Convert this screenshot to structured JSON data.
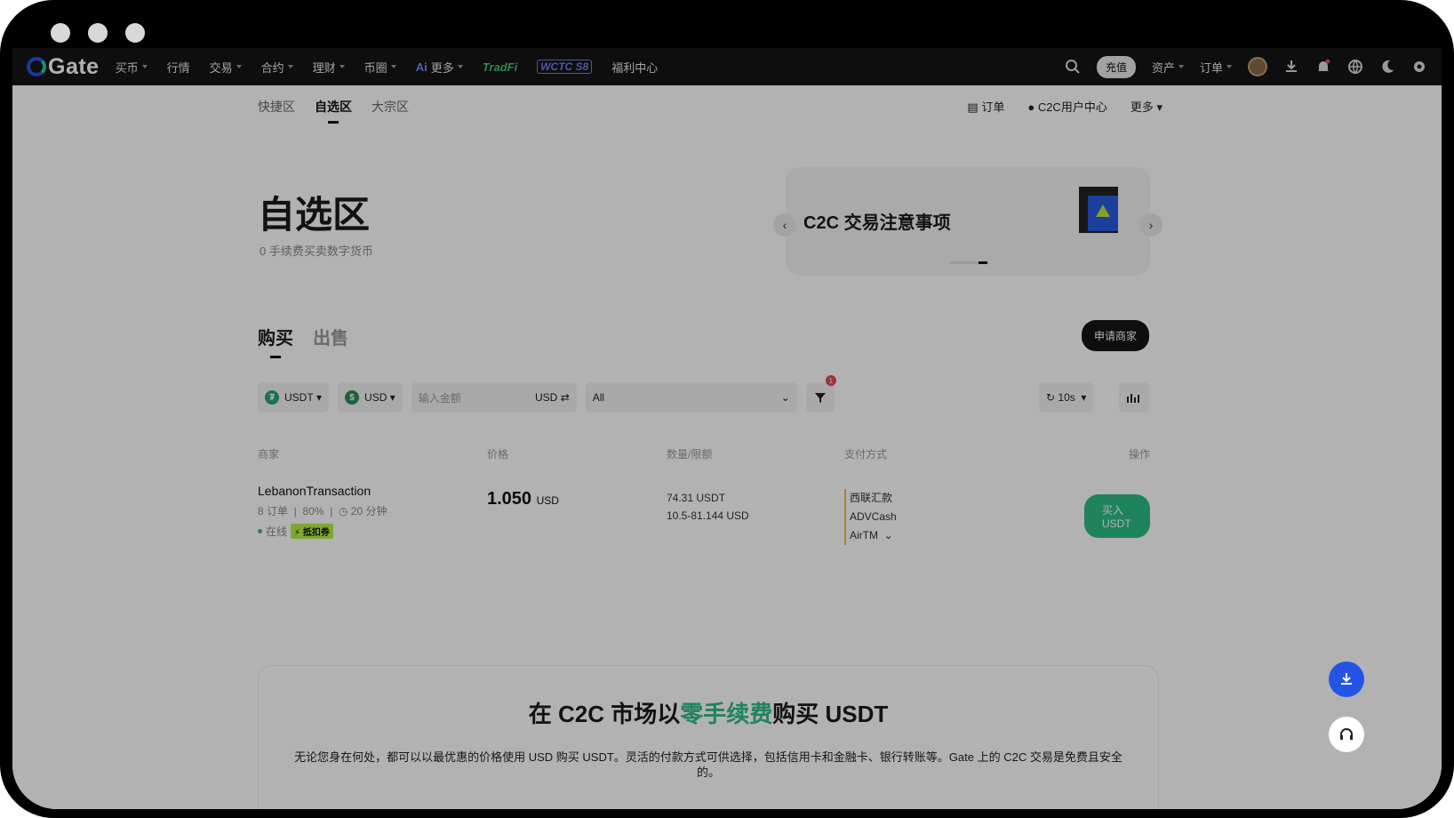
{
  "nav": {
    "logo": "Gate",
    "items": [
      {
        "label": "买币",
        "caret": true
      },
      {
        "label": "行情",
        "caret": false
      },
      {
        "label": "交易",
        "caret": true
      },
      {
        "label": "合约",
        "caret": true
      },
      {
        "label": "理财",
        "caret": true
      },
      {
        "label": "币圈",
        "caret": true
      },
      {
        "label": "更多",
        "caret": true
      }
    ],
    "tradfi": "TradFi",
    "wctc": "WCTC S8",
    "welfare": "福利中心",
    "recharge": "充值",
    "assets": "资产",
    "orders": "订单"
  },
  "subnav": {
    "tabs": [
      "快捷区",
      "自选区",
      "大宗区"
    ],
    "active": "自选区",
    "orders": "订单",
    "user_center": "C2C用户中心",
    "more": "更多"
  },
  "hero": {
    "title": "自选区",
    "subtitle": "0 手续费买卖数字货币"
  },
  "notice": {
    "text": "C2C 交易注意事项"
  },
  "trade_tabs": {
    "buy": "购买",
    "sell": "出售",
    "apply": "申请商家"
  },
  "filters": {
    "crypto": "USDT",
    "fiat": "USD",
    "amount_placeholder": "输入金额",
    "amount_currency": "USD",
    "payment": "All",
    "filter_badge": "1",
    "refresh": "10s"
  },
  "table": {
    "headers": {
      "merchant": "商家",
      "price": "价格",
      "qty": "数量/限额",
      "payment": "支付方式",
      "action": "操作"
    },
    "rows": [
      {
        "name": "LebanonTransaction",
        "orders": "8 订单",
        "rate": "80%",
        "time": "20 分钟",
        "status": "在线",
        "coupon": "抵扣券",
        "price": "1.050",
        "price_unit": "USD",
        "qty": "74.31 USDT",
        "limit": "10.5-81.144 USD",
        "payments": [
          "西联汇款",
          "ADVCash",
          "AirTM"
        ],
        "buy_label": "买入 USDT"
      }
    ]
  },
  "section": {
    "title_pre": "在 C2C 市场以",
    "title_highlight": "零手续费",
    "title_post": "购买 USDT",
    "text": "无论您身在何处，都可以以最优惠的价格使用 USD 购买 USDT。灵活的付款方式可供选择，包括信用卡和金融卡、银行转账等。Gate 上的 C2C 交易是免费且安全的。"
  }
}
